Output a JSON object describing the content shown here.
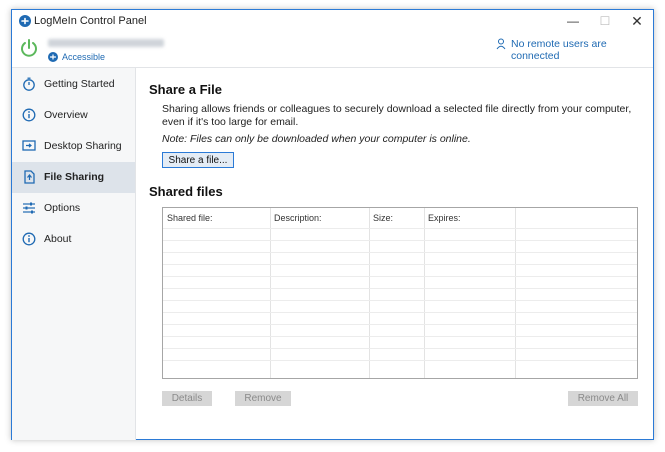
{
  "window": {
    "title": "LogMeIn Control Panel",
    "controls": {
      "minimize": "—",
      "maximize": "☐",
      "close": "✕"
    }
  },
  "status": {
    "accessible": "Accessible",
    "remote_users": "No remote users are connected"
  },
  "sidebar": {
    "items": [
      {
        "label": "Getting Started",
        "icon": "stopwatch-icon"
      },
      {
        "label": "Overview",
        "icon": "info-icon"
      },
      {
        "label": "Desktop Sharing",
        "icon": "monitor-share-icon"
      },
      {
        "label": "File Sharing",
        "icon": "file-share-icon",
        "active": true
      },
      {
        "label": "Options",
        "icon": "sliders-icon"
      },
      {
        "label": "About",
        "icon": "info-icon"
      }
    ]
  },
  "main": {
    "share_heading": "Share a File",
    "description": "Sharing allows friends or colleagues to securely download a selected file directly from your computer, even if it's too large for email.",
    "note": "Note: Files can only be downloaded when your computer is online.",
    "share_button": "Share a file...",
    "shared_heading": "Shared files",
    "table": {
      "columns": [
        "Shared file:",
        "Description:",
        "Size:",
        "Expires:"
      ]
    },
    "buttons": {
      "details": "Details",
      "remove": "Remove",
      "remove_all": "Remove All"
    }
  },
  "colors": {
    "accent": "#2b7ad6",
    "link": "#1f6ab3",
    "power": "#5cb85c",
    "active_nav": "#dde3ea"
  }
}
